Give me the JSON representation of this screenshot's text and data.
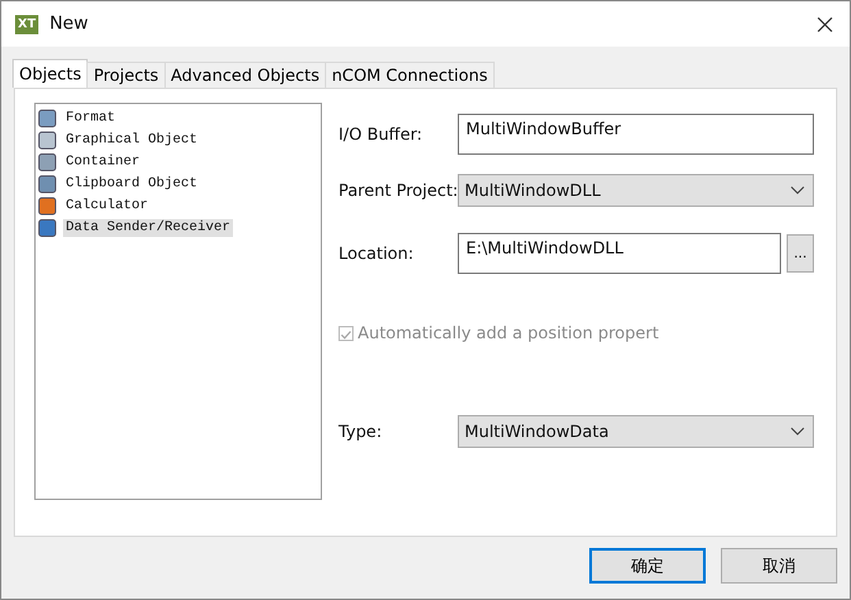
{
  "window": {
    "logo_text": "XT",
    "title": "New"
  },
  "tabs": [
    {
      "label": "Objects",
      "selected": true
    },
    {
      "label": "Projects",
      "selected": false
    },
    {
      "label": "Advanced Objects",
      "selected": false
    },
    {
      "label": "nCOM Connections",
      "selected": false
    }
  ],
  "object_list": [
    {
      "label": "Format",
      "selected": false
    },
    {
      "label": "Graphical Object",
      "selected": false
    },
    {
      "label": "Container",
      "selected": false
    },
    {
      "label": "Clipboard Object",
      "selected": false
    },
    {
      "label": "Calculator",
      "selected": false
    },
    {
      "label": "Data Sender/Receiver",
      "selected": true
    }
  ],
  "io_buffer": {
    "label": "I/O Buffer:",
    "value": "MultiWindowBuffer"
  },
  "parent_project": {
    "label": "Parent Project:",
    "value": "MultiWindowDLL"
  },
  "location": {
    "label": "Location:",
    "value": "E:\\MultiWindowDLL",
    "browse_label": "..."
  },
  "auto_position": {
    "label": "Automatically add a position propert",
    "checked": true,
    "disabled": true
  },
  "type": {
    "label": "Type:",
    "value": "MultiWindowData"
  },
  "buttons": [
    {
      "label": "确定",
      "default": true
    },
    {
      "label": "取消",
      "default": false
    }
  ]
}
